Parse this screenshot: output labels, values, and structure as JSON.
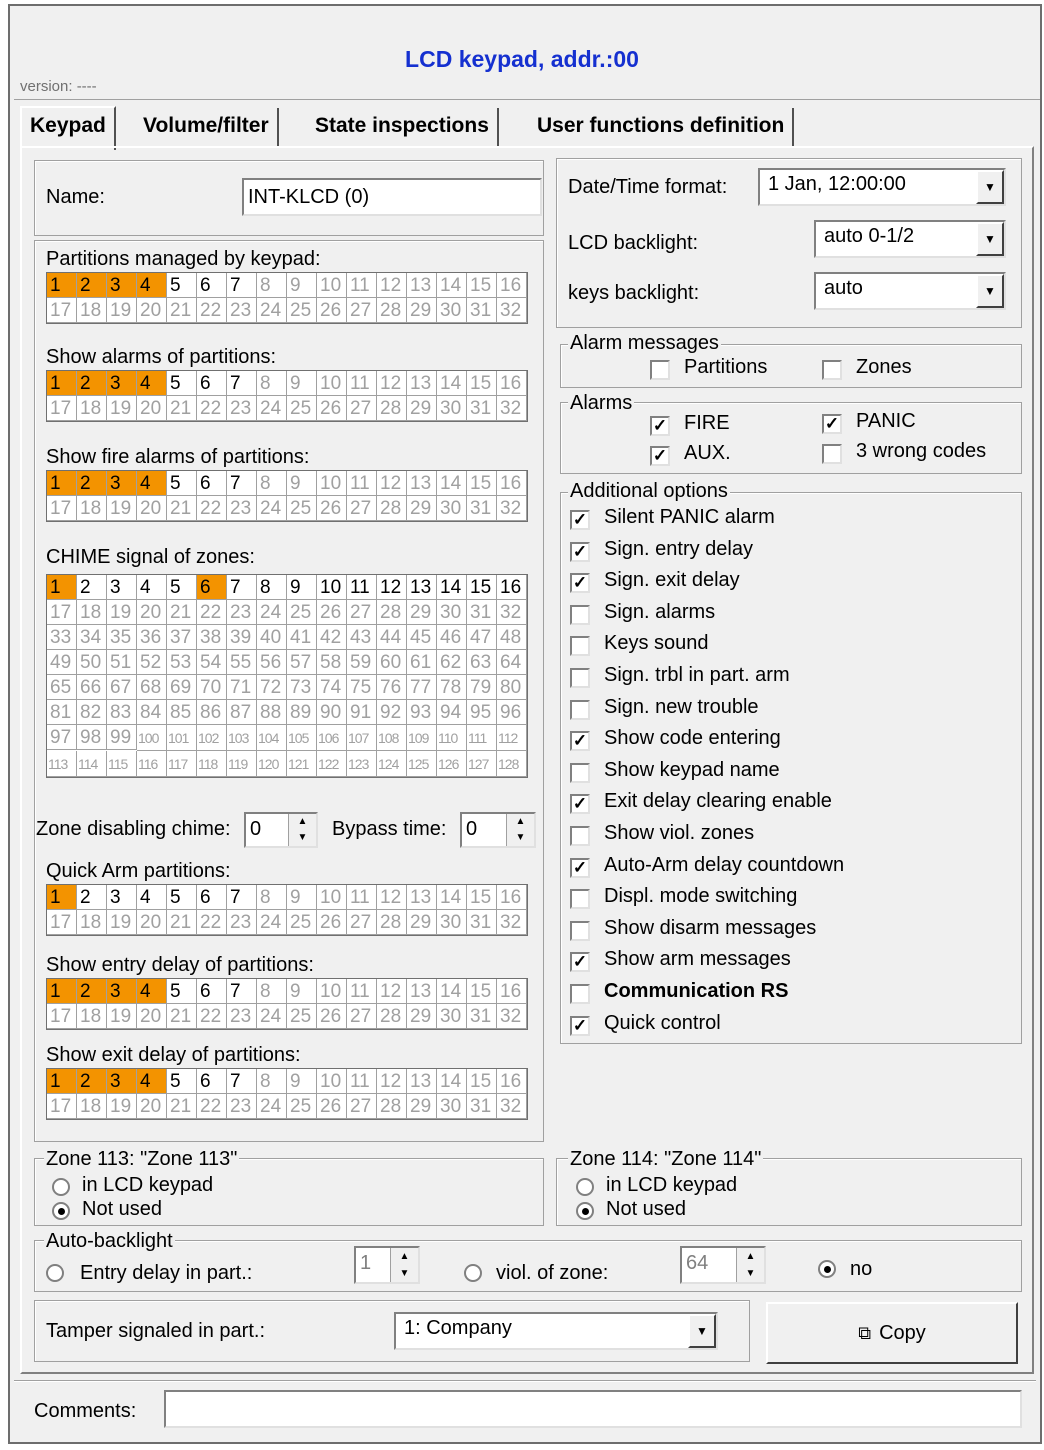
{
  "header": {
    "title": "LCD keypad, addr.:00",
    "version": "version: ----"
  },
  "tabs": [
    "Keypad",
    "Volume/filter",
    "State inspections",
    "User functions definition"
  ],
  "name": {
    "label": "Name:",
    "value": "INT-KLCD    (0)"
  },
  "partitions_sections": [
    {
      "label": "Partitions managed by keypad:",
      "on": [
        1,
        2,
        3,
        4
      ]
    },
    {
      "label": "Show alarms of partitions:",
      "on": [
        1,
        2,
        3,
        4
      ]
    },
    {
      "label": "Show fire alarms of partitions:",
      "on": [
        1,
        2,
        3,
        4
      ]
    }
  ],
  "chime": {
    "label": "CHIME signal of zones:",
    "on": [
      1,
      6
    ]
  },
  "zone_disabling_chime": {
    "label": "Zone disabling chime:",
    "value": "0"
  },
  "bypass_time": {
    "label": "Bypass time:",
    "value": "0"
  },
  "partitions_sections_2": [
    {
      "label": "Quick Arm partitions:",
      "on": [
        1
      ]
    },
    {
      "label": "Show entry delay of partitions:",
      "on": [
        1,
        2,
        3,
        4
      ]
    },
    {
      "label": "Show exit delay of partitions:",
      "on": [
        1,
        2,
        3,
        4
      ]
    }
  ],
  "active_partitions_max": 7,
  "datetime": {
    "label": "Date/Time format:",
    "value": "1 Jan, 12:00:00"
  },
  "lcd_backlight": {
    "label": "LCD backlight:",
    "value": "auto 0-1/2"
  },
  "keys_backlight": {
    "label": "keys backlight:",
    "value": "auto"
  },
  "alarm_messages": {
    "label": "Alarm messages",
    "items": [
      {
        "label": "Partitions",
        "checked": false
      },
      {
        "label": "Zones",
        "checked": false
      }
    ]
  },
  "alarms": {
    "label": "Alarms",
    "items": [
      {
        "label": "FIRE",
        "checked": true
      },
      {
        "label": "PANIC",
        "checked": true
      },
      {
        "label": "AUX.",
        "checked": true
      },
      {
        "label": "3 wrong codes",
        "checked": false
      }
    ]
  },
  "additional": {
    "label": "Additional options",
    "items": [
      {
        "label": "Silent PANIC alarm",
        "checked": true
      },
      {
        "label": "Sign. entry delay",
        "checked": true
      },
      {
        "label": "Sign. exit delay",
        "checked": true
      },
      {
        "label": "Sign. alarms",
        "checked": false
      },
      {
        "label": "Keys sound",
        "checked": false
      },
      {
        "label": "Sign. trbl in part. arm",
        "checked": false
      },
      {
        "label": "Sign. new trouble",
        "checked": false
      },
      {
        "label": "Show code entering",
        "checked": true
      },
      {
        "label": "Show keypad name",
        "checked": false
      },
      {
        "label": "Exit delay clearing enable",
        "checked": true
      },
      {
        "label": "Show viol. zones",
        "checked": false
      },
      {
        "label": "Auto-Arm delay countdown",
        "checked": true
      },
      {
        "label": "Displ. mode switching",
        "checked": false
      },
      {
        "label": "Show disarm messages",
        "checked": false
      },
      {
        "label": "Show arm messages",
        "checked": true
      },
      {
        "label": "Communication RS",
        "checked": false,
        "bold": true
      },
      {
        "label": "Quick control",
        "checked": true
      }
    ]
  },
  "zone113": {
    "label": "Zone 113: \"Zone 113\"",
    "opt1": "in LCD keypad",
    "opt2": "Not used"
  },
  "zone114": {
    "label": "Zone 114: \"Zone 114\"",
    "opt1": "in LCD keypad",
    "opt2": "Not used"
  },
  "auto_backlight": {
    "label": "Auto-backlight",
    "entry_label": "Entry delay in part.:",
    "entry_value": "1",
    "viol_label": "viol. of zone:",
    "viol_value": "64",
    "no_label": "no"
  },
  "tamper": {
    "label": "Tamper signaled in part.:",
    "value": "1: Company"
  },
  "copy_button": "Copy",
  "comments": {
    "label": "Comments:",
    "value": ""
  }
}
